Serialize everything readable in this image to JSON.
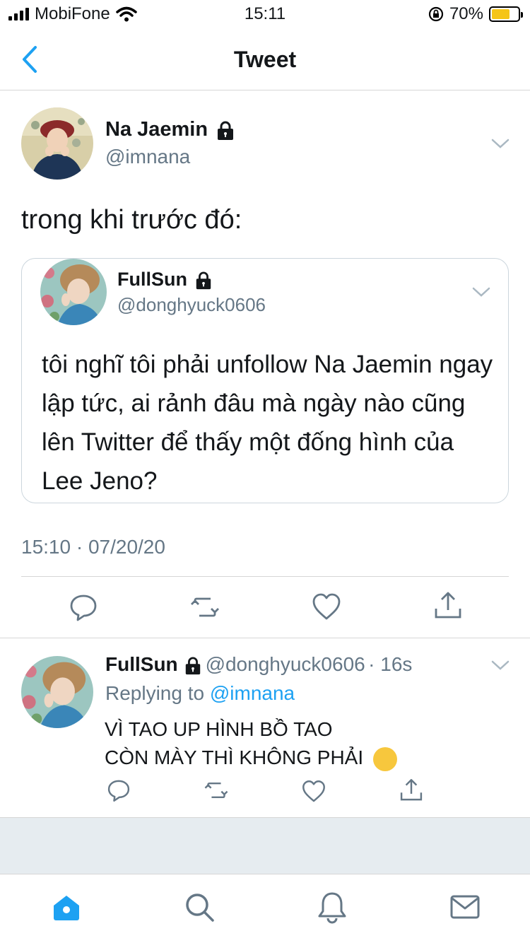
{
  "status_bar": {
    "carrier": "MobiFone",
    "time": "15:11",
    "battery": "70%",
    "battery_level": 0.7
  },
  "nav": {
    "title": "Tweet",
    "back_icon": "chevron-left-icon"
  },
  "tweet": {
    "author_name": "Na Jaemin",
    "author_handle": "@imnana",
    "text": "trong khi trước đó:",
    "timestamp": "15:10 · 07/20/20",
    "quoted": {
      "author_name": "FullSun",
      "author_handle": "@donghyuck0606",
      "text": "tôi nghĩ tôi phải unfollow Na Jaemin ngay lập tức, ai rảnh đâu mà ngày nào cũng lên Twitter để thấy một đống hình của Lee Jeno?"
    },
    "actions": [
      "reply-icon",
      "retweet-icon",
      "like-icon",
      "share-icon"
    ]
  },
  "reply": {
    "author_name": "FullSun",
    "author_handle": "@donghyuck0606",
    "time_ago": "· 16s",
    "replying_to_label": "Replying to",
    "replying_to_handle": "@imnana",
    "line1": "VÌ TAO UP HÌNH BỒ TAO",
    "line2": "CÒN MÀY THÌ KHÔNG PHẢI",
    "emoji": "😏"
  },
  "tabs": [
    "home-icon",
    "search-icon",
    "notifications-icon",
    "messages-icon"
  ],
  "colors": {
    "accent": "#1da1f2",
    "secondary_text": "#657786",
    "divider": "#d6d6d6",
    "background_gray": "#e6ecf0"
  }
}
